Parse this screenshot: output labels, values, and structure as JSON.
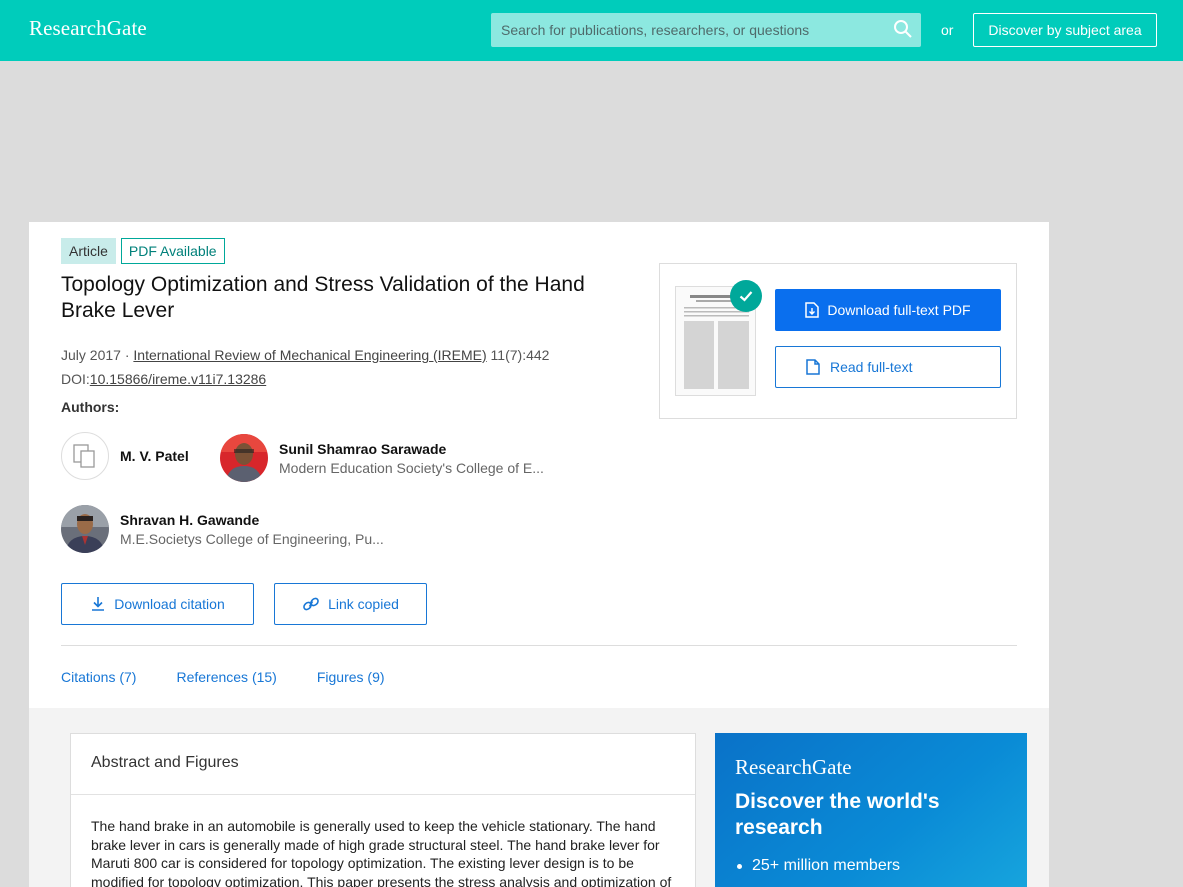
{
  "header": {
    "logo": "ResearchGate",
    "search_placeholder": "Search for publications, researchers, or questions",
    "or_label": "or",
    "discover_button": "Discover by subject area"
  },
  "article": {
    "badge_type": "Article",
    "badge_pdf": "PDF Available",
    "title": "Topology Optimization and Stress Validation of the Hand Brake Lever",
    "date": "July 2017",
    "separator": " · ",
    "journal": "International Review of Mechanical Engineering (IREME)",
    "volume": " 11(7):442",
    "doi_label": "DOI:",
    "doi": "10.15866/ireme.v11i7.13286",
    "authors_heading": "Authors:",
    "authors": [
      {
        "name": "M. V. Patel",
        "affiliation": ""
      },
      {
        "name": "Sunil Shamrao Sarawade",
        "affiliation": "Modern Education Society's College of E..."
      },
      {
        "name": "Shravan H. Gawande",
        "affiliation": "M.E.Societys College of Engineering, Pu..."
      }
    ],
    "download_citation": "Download citation",
    "link_copied": "Link copied",
    "tabs": [
      "Citations (7)",
      "References (15)",
      "Figures (9)"
    ]
  },
  "pdf_panel": {
    "download_pdf": "Download full-text PDF",
    "read_full_text": "Read full-text"
  },
  "abstract": {
    "heading": "Abstract and Figures",
    "lines": [
      "The hand brake in an automobile is generally used to keep the vehicle stationary. The hand",
      "brake lever in cars is generally made of high grade structural steel. The hand brake lever for",
      "Maruti 800 car is considered for topology optimization. The existing lever design is to be",
      "modified for topology optimization. This paper presents the stress analysis and optimization of"
    ]
  },
  "promo": {
    "logo": "ResearchGate",
    "heading": "Discover the world's research",
    "bullet1": "25+ million members"
  },
  "colors": {
    "brand": "#00ccbb",
    "link_blue": "#1877d6",
    "primary_button": "#0a6fee",
    "check_teal": "#00a89a"
  }
}
